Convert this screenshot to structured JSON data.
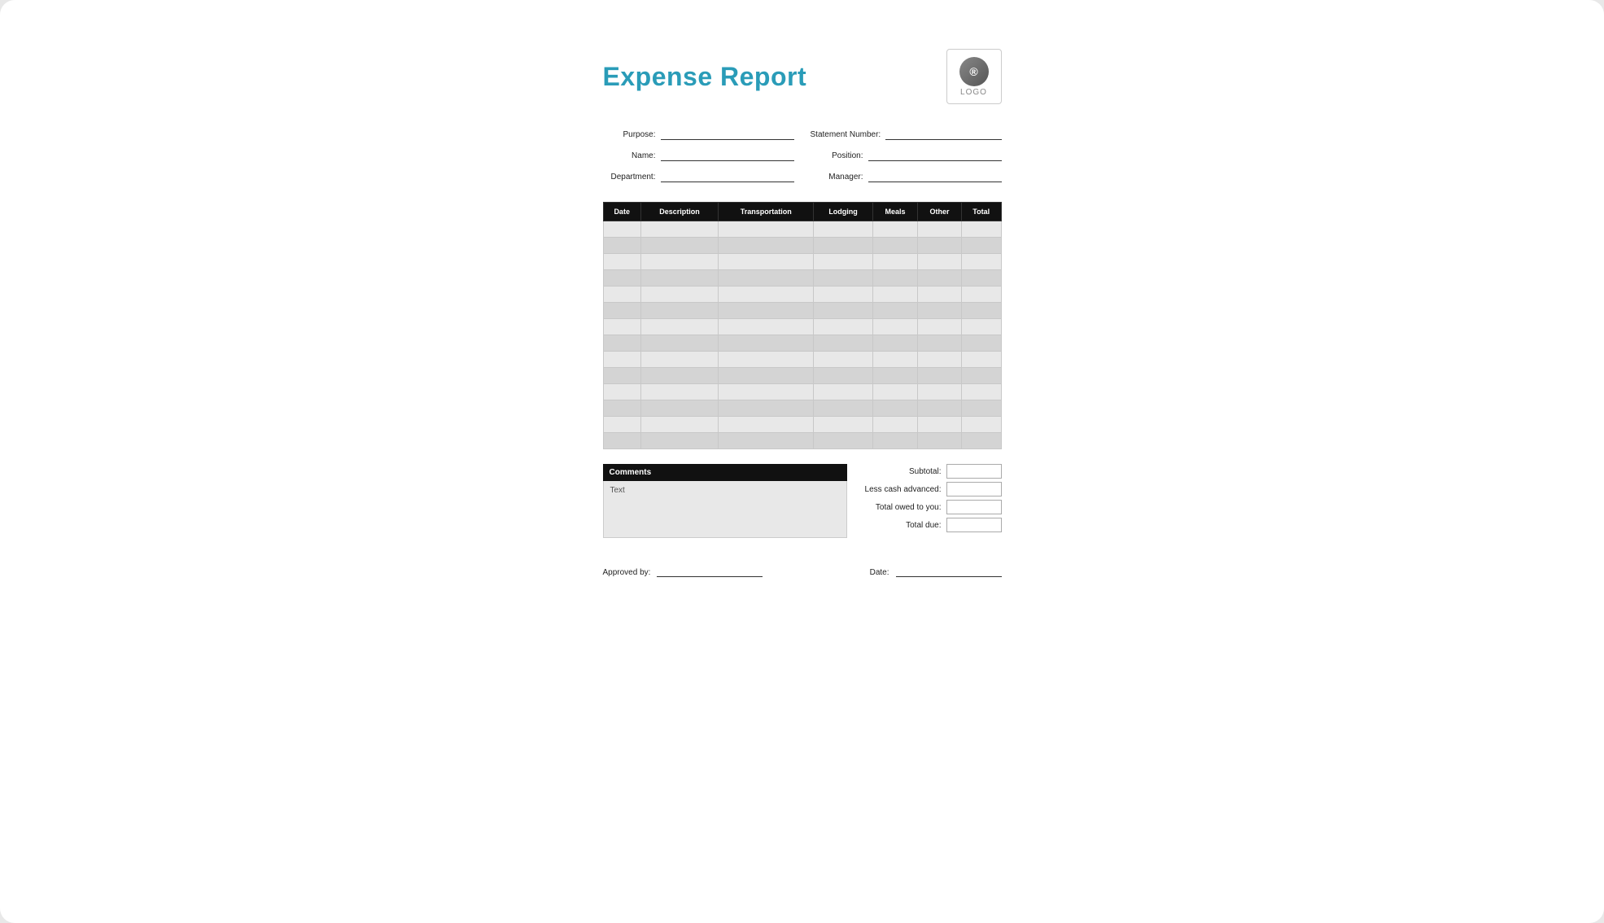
{
  "header": {
    "title": "Expense Report",
    "logo_text": "LOGO",
    "logo_symbol": "®"
  },
  "form": {
    "purpose_label": "Purpose:",
    "name_label": "Name:",
    "department_label": "Department:",
    "statement_number_label": "Statement Number:",
    "position_label": "Position:",
    "manager_label": "Manager:"
  },
  "table": {
    "columns": [
      "Date",
      "Description",
      "Transportation",
      "Lodging",
      "Meals",
      "Other",
      "Total"
    ],
    "row_count": 14
  },
  "comments": {
    "header": "Comments",
    "placeholder": "Text"
  },
  "totals": {
    "subtotal_label": "Subtotal:",
    "less_cash_label": "Less cash advanced:",
    "total_owed_label": "Total owed to you:",
    "total_due_label": "Total due:"
  },
  "approval": {
    "approved_by_label": "Approved by:",
    "date_label": "Date:"
  }
}
